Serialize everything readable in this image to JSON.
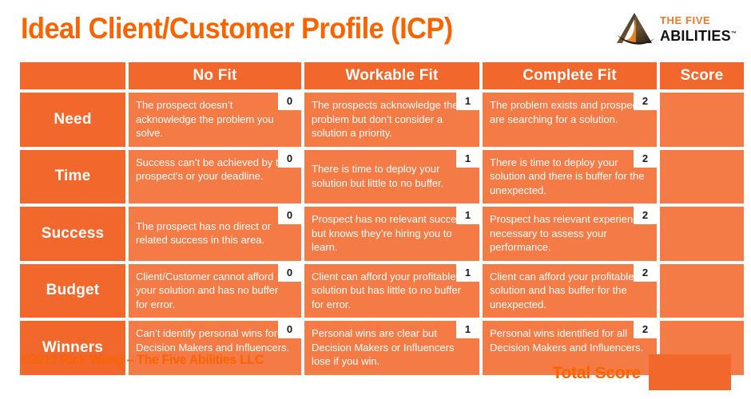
{
  "header": {
    "title": "Ideal Client/Customer Profile (ICP)",
    "logo": {
      "line1": "THE FIVE",
      "line2": "ABILITIES",
      "trademark": "™",
      "mark_icon": "triangle-swoosh-logo-icon"
    }
  },
  "table": {
    "columns": [
      "",
      "No Fit",
      "Workable Fit",
      "Complete Fit",
      "Score"
    ],
    "rows": [
      {
        "label": "Need",
        "no_fit": {
          "text": "The prospect doesn’t acknowledge the problem you solve.",
          "score": "0"
        },
        "workable_fit": {
          "text": "The prospects acknowledge the problem but don’t consider a solution a priority.",
          "score": "1"
        },
        "complete_fit": {
          "text": "The problem exists and prospects are searching for a solution.",
          "score": "2"
        },
        "score": ""
      },
      {
        "label": "Time",
        "no_fit": {
          "text": "Success can’t be achieved by the prospect’s or your deadline.",
          "score": "0"
        },
        "workable_fit": {
          "text": "There is time to deploy your solution but little to no buffer.",
          "score": "1"
        },
        "complete_fit": {
          "text": "There is time to deploy your solution and there is buffer for the unexpected.",
          "score": "2"
        },
        "score": ""
      },
      {
        "label": "Success",
        "no_fit": {
          "text": "The prospect has no direct or related success in this area.",
          "score": "0"
        },
        "workable_fit": {
          "text": "Prospect has no relevant success but knows they’re hiring you to learn.",
          "score": "1"
        },
        "complete_fit": {
          "text": "Prospect has relevant experience necessary to assess your performance.",
          "score": "2"
        },
        "score": ""
      },
      {
        "label": "Budget",
        "no_fit": {
          "text": "Client/Customer cannot afford your solution and has no buffer for error.",
          "score": "0"
        },
        "workable_fit": {
          "text": "Client can afford your profitable solution but has little to no buffer for error.",
          "score": "1"
        },
        "complete_fit": {
          "text": "Client can afford your profitable solution and has buffer for the unexpected.",
          "score": "2"
        },
        "score": ""
      },
      {
        "label": "Winners",
        "no_fit": {
          "text": "Can’t identify personal wins for Decision Makers and Influencers.",
          "score": "0"
        },
        "workable_fit": {
          "text": "Personal wins are clear but Decision Makers or Influencers lose if you win.",
          "score": "1"
        },
        "complete_fit": {
          "text": "Personal wins identified for all Decision Makers and Influencers.",
          "score": "2"
        },
        "score": ""
      }
    ]
  },
  "footer": {
    "copyright": "©2013 Rick Wong – The Five Abilities LLC",
    "total_score_label": "Total Score",
    "total_score_value": ""
  },
  "colors": {
    "brand_orange": "#FA6400",
    "header_orange": "#F2672B",
    "cell_orange": "#F47B45",
    "badge_bg": "#FFFFFF",
    "badge_text": "#1A1A1A",
    "text_white": "#FFFFFF"
  }
}
